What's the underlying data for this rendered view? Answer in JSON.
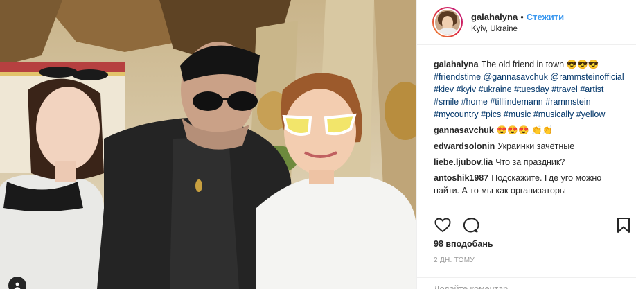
{
  "header": {
    "username": "galahalyna",
    "separator": "•",
    "follow_label": "Стежити",
    "location": "Kyiv, Ukraine",
    "avatar_icon": "profile-avatar"
  },
  "caption": {
    "username": "galahalyna",
    "text": "The old friend in town ",
    "emoji": "😎😎😎",
    "tags": [
      "#friendstime",
      "@gannasavchuk",
      "@rammsteinofficial",
      "#kiev",
      "#kyiv",
      "#ukraine",
      "#tuesday",
      "#travel",
      "#artist",
      "#smile",
      "#home",
      "#tilllindemann",
      "#rammstein",
      "#mycountry",
      "#pics",
      "#music",
      "#musically",
      "#yellow"
    ]
  },
  "comments": [
    {
      "username": "gannasavchuk",
      "text": "😍😍😍 👏👏"
    },
    {
      "username": "edwardsolonin",
      "text": "Украинки зачётные"
    },
    {
      "username": "liebe.ljubov.lia",
      "text": "Что за праздник?"
    },
    {
      "username": "antoshik1987",
      "text": "Подскажите. Где уго можно найти. А то мы как организаторы"
    }
  ],
  "actions": {
    "like_icon": "heart-icon",
    "comment_icon": "comment-icon",
    "save_icon": "bookmark-icon"
  },
  "likes": "98 вподобань",
  "timestamp": "2 дн. тому",
  "add_comment": {
    "placeholder": "Додайте коментар..."
  },
  "colors": {
    "link": "#003569",
    "follow": "#3897f0",
    "border": "#efefef",
    "muted": "#999999"
  }
}
